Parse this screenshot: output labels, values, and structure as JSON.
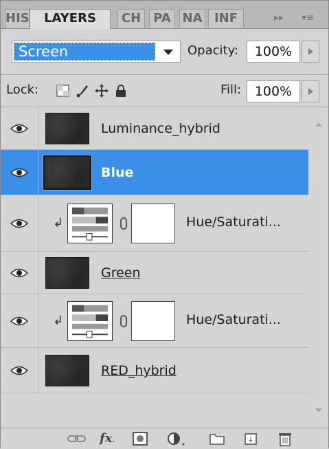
{
  "tabs": [
    {
      "label": "HIS",
      "active": false
    },
    {
      "label": "LAYERS",
      "active": true
    },
    {
      "label": "CH",
      "active": false
    },
    {
      "label": "PA",
      "active": false
    },
    {
      "label": "NA",
      "active": false
    },
    {
      "label": "INF",
      "active": false
    }
  ],
  "tab_controls": {
    "expand": "▸▸",
    "menu": "▾≡"
  },
  "blend_mode": {
    "value": "Screen"
  },
  "opacity": {
    "label": "Opacity:",
    "value": "100%"
  },
  "lock": {
    "label": "Lock:"
  },
  "fill": {
    "label": "Fill:",
    "value": "100%"
  },
  "layers": [
    {
      "name": "Luminance_hybrid",
      "type": "pixel",
      "visible": true,
      "selected": false
    },
    {
      "name": "Blue",
      "type": "pixel",
      "visible": true,
      "selected": true
    },
    {
      "name": "Hue/Saturati...",
      "type": "adjustment",
      "visible": true,
      "selected": false,
      "clipped": true
    },
    {
      "name": "Green",
      "type": "pixel",
      "visible": true,
      "selected": false
    },
    {
      "name": "Hue/Saturati...",
      "type": "adjustment",
      "visible": true,
      "selected": false,
      "clipped": true
    },
    {
      "name": "RED_hybrid",
      "type": "pixel",
      "visible": true,
      "selected": false
    }
  ],
  "toolbar_icons": [
    "link-layers-icon",
    "fx-icon",
    "add-mask-icon",
    "adjustment-layer-icon",
    "group-folder-icon",
    "new-layer-icon",
    "trash-icon"
  ],
  "colors": {
    "selection": "#3c8fe8",
    "panel": "#d4d4d4"
  }
}
